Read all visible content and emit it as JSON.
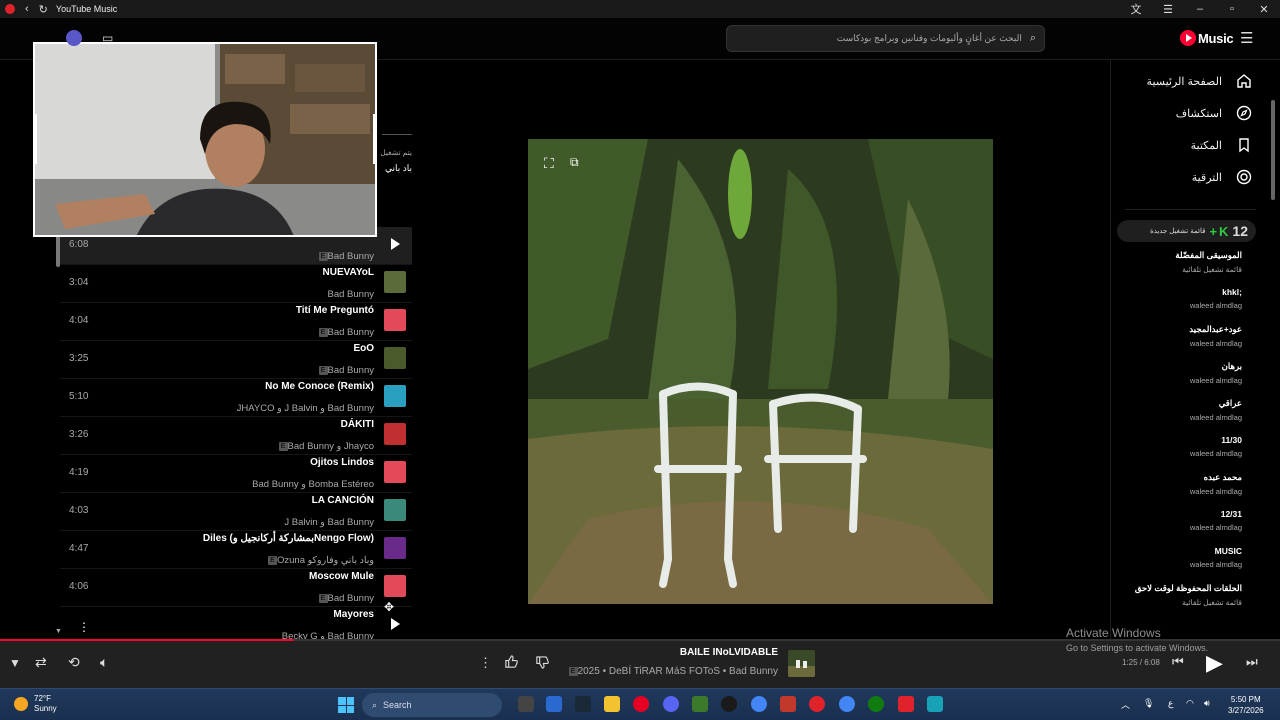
{
  "window": {
    "title": "YouTube Music"
  },
  "header": {
    "search_placeholder": "البحث عن أغانٍ وألبومات وفنانين وبرامج بودكاست",
    "logo_text": "Music"
  },
  "sidebar": {
    "nav": [
      {
        "label": "الصفحة الرئيسية",
        "icon": "home-icon"
      },
      {
        "label": "استكشاف",
        "icon": "explore-icon"
      },
      {
        "label": "المكتبة",
        "icon": "library-icon"
      },
      {
        "label": "الترقية",
        "icon": "upgrade-icon"
      }
    ],
    "new_playlist": {
      "count": "12",
      "label": "قائمة تشغيل جديدة"
    },
    "playlists": [
      {
        "title": "الموسيقى المفضّلة",
        "subtitle": "قائمة تشغيل تلقائية"
      },
      {
        "title": ";khkl",
        "subtitle": "waleed almdlag"
      },
      {
        "title": "عود+عبدالمجيد",
        "subtitle": "waleed almdlag"
      },
      {
        "title": "برهان",
        "subtitle": "waleed almdlag"
      },
      {
        "title": "عراقي",
        "subtitle": "waleed almdlag"
      },
      {
        "title": "11/30",
        "subtitle": "waleed almdlag"
      },
      {
        "title": "محمد عبده",
        "subtitle": "waleed almdlag"
      },
      {
        "title": "12/31",
        "subtitle": "waleed almdlag"
      },
      {
        "title": "MUSIC",
        "subtitle": "waleed almdlag"
      },
      {
        "title": "الحلقات المحفوظة لوقت لاحق",
        "subtitle": "قائمة تشغيل تلقائية"
      }
    ]
  },
  "queue": {
    "playing_from_label": "يتم تشغيل",
    "playing_from_value": "باد باني",
    "rows": [
      {
        "title": "BAILE INoLVIDABLE",
        "artist": "Bad Bunny",
        "explicit": true,
        "duration": "6:08",
        "active": true,
        "art_color": "#3b5a2a"
      },
      {
        "title": "NUEVAYoL",
        "artist": "Bad Bunny",
        "explicit": false,
        "duration": "3:04",
        "active": false,
        "art_color": "#5b6b3a"
      },
      {
        "title": "Tití Me Preguntó",
        "artist": "Bad Bunny",
        "explicit": true,
        "duration": "4:04",
        "active": false,
        "art_color": "#e24a5a"
      },
      {
        "title": "EoO",
        "artist": "Bad Bunny",
        "explicit": true,
        "duration": "3:25",
        "active": false,
        "art_color": "#4a5a2a"
      },
      {
        "title": "No Me Conoce (Remix)",
        "artist": "JHAYCO و J Balvin و Bad Bunny",
        "explicit": false,
        "duration": "5:10",
        "active": false,
        "art_color": "#2aa0c0"
      },
      {
        "title": "DÁKITI",
        "artist": "Bad Bunny و Jhayco",
        "explicit": true,
        "duration": "3:26",
        "active": false,
        "art_color": "#c03030"
      },
      {
        "title": "Ojitos Lindos",
        "artist": "Bad Bunny و Bomba Estéreo",
        "explicit": false,
        "duration": "4:19",
        "active": false,
        "art_color": "#e24a5a"
      },
      {
        "title": "LA CANCIÓN",
        "artist": "J Balvin و Bad Bunny",
        "explicit": false,
        "duration": "4:03",
        "active": false,
        "art_color": "#3a8a7a"
      },
      {
        "title": "Diles (بمشاركة أركانجيل وNengo Flow)",
        "artist": "Ozuna وباد باني وفاروكو",
        "explicit": true,
        "duration": "4:47",
        "active": false,
        "art_color": "#6a2a8a"
      },
      {
        "title": "Moscow Mule",
        "artist": "Bad Bunny",
        "explicit": true,
        "duration": "4:06",
        "active": false,
        "art_color": "#e24a5a"
      },
      {
        "title": "Mayores",
        "artist": "Becky G و Bad Bunny",
        "explicit": false,
        "duration": "",
        "active": false,
        "art_color": "#2a2a2a"
      }
    ]
  },
  "player": {
    "title": "BAILE INoLVIDABLE",
    "meta": "2025 • DeBÍ TiRAR MáS FOToS • Bad Bunny",
    "explicit_badge": "E",
    "time": "1:25 / 6:08",
    "progress_fraction": 0.23
  },
  "watermark": {
    "line1": "Activate Windows",
    "line2": "Go to Settings to activate Windows."
  },
  "taskbar": {
    "weather_temp": "72°F",
    "weather_desc": "Sunny",
    "search_label": "Search",
    "time": "5:50 PM",
    "date": "3/27/2026",
    "lang": "ع"
  },
  "colors": {
    "accent": "#ff0033",
    "bg": "#000000",
    "panel": "#212121"
  }
}
